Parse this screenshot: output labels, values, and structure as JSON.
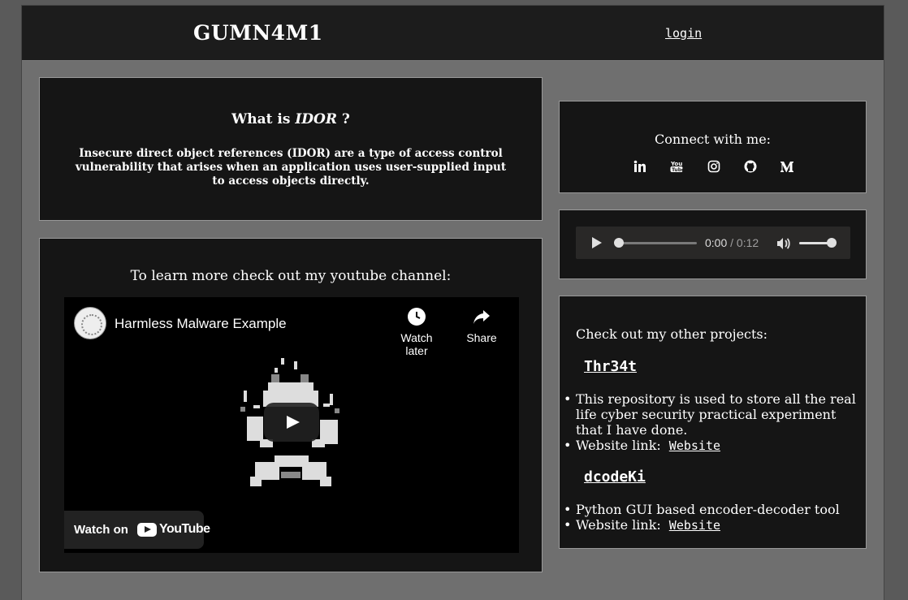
{
  "header": {
    "title": "GUMN4M1",
    "login_label": "login"
  },
  "idor": {
    "heading_prefix": "What is ",
    "heading_term": "IDOR",
    "heading_suffix": " ?",
    "description": "Insecure direct object references (IDOR) are a type of access control vulnerability that arises when an application uses user-supplied input to access objects directly."
  },
  "youtube": {
    "lead": "To learn more check out my youtube channel:",
    "video_title": "Harmless Malware Example",
    "watch_later_label": "Watch later",
    "share_label": "Share",
    "watch_on_label": "Watch on",
    "youtube_word": "YouTube"
  },
  "connect": {
    "lead": "Connect with me:",
    "icons": [
      "linkedin-icon",
      "youtube-icon",
      "instagram-icon",
      "github-icon",
      "medium-icon"
    ]
  },
  "audio": {
    "current_time": "0:00",
    "separator": " / ",
    "duration": "0:12",
    "progress": 0,
    "volume": 1
  },
  "projects": {
    "lead": "Check out my other projects:",
    "items": [
      {
        "name": "Thr34t",
        "description": "This repository is used to store all the real life cyber security practical experiment that I have done.",
        "link_label": "Website link:",
        "link_text": "Website"
      },
      {
        "name": "dcodeKi",
        "description": "Python GUI based encoder-decoder tool",
        "link_label": "Website link:",
        "link_text": "Website"
      }
    ]
  },
  "colors": {
    "card_bg": "#151515",
    "page_bg": "#6f6f6f",
    "header_bg": "#1c1c1c",
    "border": "#9a9a9a"
  }
}
